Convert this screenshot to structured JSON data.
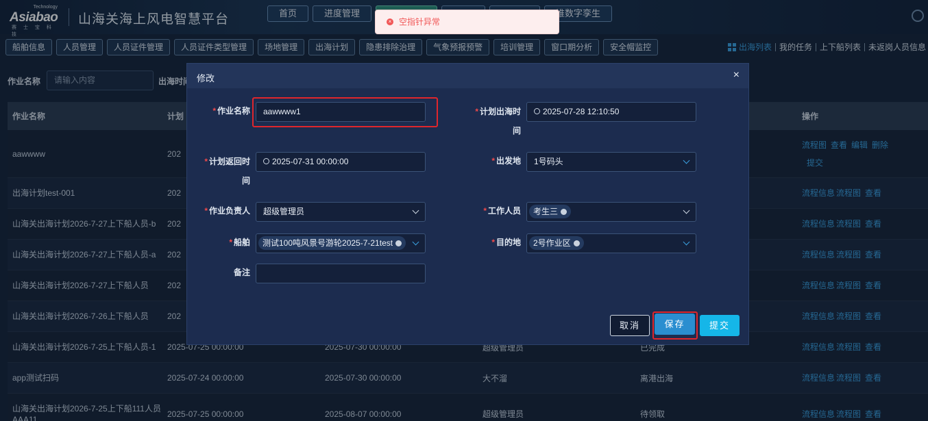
{
  "header": {
    "logo_tech": "Technology",
    "logo_brand": "Asiabao",
    "logo_sub": "赛 士 宝 科 技",
    "title": "山海关海上风电智慧平台",
    "nav": [
      "首页",
      "进度管理",
      "",
      "",
      "",
      "谁数字孪生"
    ],
    "active_nav_index": 2
  },
  "subnav": {
    "items": [
      "船舶信息",
      "人员管理",
      "人员证件管理",
      "人员证件类型管理",
      "场地管理",
      "出海计划",
      "隐患排除治理",
      "气象预报预警",
      "培训管理",
      "窗口期分析",
      "安全帽监控"
    ],
    "right_links": [
      "出海列表",
      "我的任务",
      "上下船列表",
      "未返岗人员信息"
    ]
  },
  "filter": {
    "label1": "作业名称",
    "placeholder": "请输入内容",
    "label2": "出海时间"
  },
  "table": {
    "headers": [
      "作业名称",
      "计划",
      "",
      "",
      "",
      "操作"
    ],
    "rows": [
      {
        "name": "aawwww",
        "c2": "202",
        "c3": "",
        "c4": "",
        "c5": "",
        "ops": [
          "流程图",
          "查看",
          "编辑",
          "删除",
          "提交"
        ]
      },
      {
        "name": "出海计划test-001",
        "c2": "202",
        "c3": "",
        "c4": "",
        "c5": "",
        "ops": [
          "流程信息",
          "流程图",
          "查看"
        ]
      },
      {
        "name": "山海关出海计划2026-7-27上下船人员-b",
        "c2": "202",
        "c3": "",
        "c4": "",
        "c5": "",
        "ops": [
          "流程信息",
          "流程图",
          "查看"
        ]
      },
      {
        "name": "山海关出海计划2026-7-27上下船人员-a",
        "c2": "202",
        "c3": "",
        "c4": "",
        "c5": "",
        "ops": [
          "流程信息",
          "流程图",
          "查看"
        ]
      },
      {
        "name": "山海关出海计划2026-7-27上下船人员",
        "c2": "202",
        "c3": "",
        "c4": "",
        "c5": "",
        "ops": [
          "流程信息",
          "流程图",
          "查看"
        ]
      },
      {
        "name": "山海关出海计划2026-7-26上下船人员",
        "c2": "202",
        "c3": "",
        "c4": "",
        "c5": "",
        "ops": [
          "流程信息",
          "流程图",
          "查看"
        ]
      },
      {
        "name": "山海关出海计划2026-7-25上下船人员-1",
        "c2": "2025-07-25 00:00:00",
        "c3": "2025-07-30 00:00:00",
        "c4": "超级管理员",
        "c5": "已完成",
        "ops": [
          "流程信息",
          "流程图",
          "查看"
        ]
      },
      {
        "name": "app测试扫码",
        "c2": "2025-07-24 00:00:00",
        "c3": "2025-07-30 00:00:00",
        "c4": "大不溜",
        "c5": "离港出海",
        "ops": [
          "流程信息",
          "流程图",
          "查看"
        ]
      },
      {
        "name": "山海关出海计划2026-7-25上下船111人员AAA11",
        "c2": "2025-07-25 00:00:00",
        "c3": "2025-08-07 00:00:00",
        "c4": "超级管理员",
        "c5": "待领取",
        "ops": [
          "流程信息",
          "流程图",
          "查看"
        ]
      }
    ]
  },
  "modal": {
    "title": "修改",
    "close": "×",
    "fields": {
      "job_name": {
        "label": "作业名称",
        "value": "aawwww1"
      },
      "plan_out_time": {
        "label1": "计划出海时",
        "label2": "间",
        "value": "2025-07-28 12:10:50"
      },
      "plan_return_time": {
        "label1": "计划返回时",
        "label2": "间",
        "value": "2025-07-31 00:00:00"
      },
      "departure": {
        "label": "出发地",
        "value": "1号码头"
      },
      "job_leader": {
        "label": "作业负责人",
        "value": "超级管理员"
      },
      "workers": {
        "label": "工作人员",
        "tag": "考生三"
      },
      "ship": {
        "label": "船舶",
        "tag": "测试100吨风景号游轮2025-7-21test"
      },
      "destination": {
        "label": "目的地",
        "tag": "2号作业区"
      },
      "remark": {
        "label": "备注",
        "value": ""
      }
    },
    "buttons": {
      "cancel": "取消",
      "save": "保存",
      "submit": "提交"
    }
  },
  "toast": {
    "message": "空指针异常"
  },
  "colors": {
    "accent": "#3aa0e0",
    "danger": "#f04a4a",
    "highlight": "#e0262c"
  }
}
